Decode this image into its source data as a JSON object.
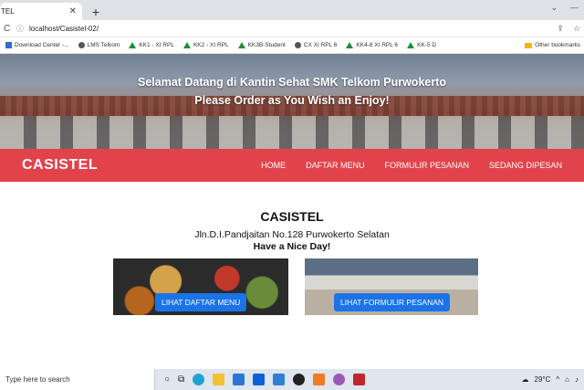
{
  "browser": {
    "tab_title": "TEL",
    "tab_close": "✕",
    "new_tab": "+",
    "tabbar_right": [
      "⌄",
      "—"
    ],
    "url": "localhost/Casistel-02/",
    "reload_icon": "C",
    "info_icon": "ⓘ",
    "bookmarks": [
      {
        "label": "Download Center -...",
        "icon": "sq"
      },
      {
        "label": "LMS Telkom",
        "icon": "round"
      },
      {
        "label": "KK1 - XI RPL",
        "icon": "tri"
      },
      {
        "label": "KK2 - XI RPL",
        "icon": "tri"
      },
      {
        "label": "KK3B-Student",
        "icon": "tri"
      },
      {
        "label": "CX XI RPL 6",
        "icon": "round"
      },
      {
        "label": "KK4-8 XI RPL 6",
        "icon": "tri"
      },
      {
        "label": "KK-5 D",
        "icon": "tri"
      }
    ],
    "other_bookmarks": "Other bookmarks"
  },
  "hero": {
    "line1": "Selamat Datang di Kantin Sehat SMK Telkom Purwokerto",
    "line2": "Please Order as You Wish an Enjoy!"
  },
  "navbar": {
    "brand": "CASISTEL",
    "menu": [
      "HOME",
      "DAFTAR MENU",
      "FORMULIR PESANAN",
      "SEDANG DIPESAN"
    ]
  },
  "info": {
    "title": "CASISTEL",
    "address": "Jln.D.I.Pandjaitan No.128 Purwokerto Selatan",
    "tagline": "Have a Nice Day!"
  },
  "cards": {
    "menu_button": "LIHAT DAFTAR MENU",
    "form_button": "LIHAT FORMULIR PESANAN"
  },
  "taskbar": {
    "search_placeholder": "Type here to search",
    "temperature": "29°C",
    "tray_icons": [
      "^",
      "⌂",
      "♪"
    ]
  },
  "colors": {
    "navbar": "#e2434b",
    "button": "#1a73e8"
  }
}
